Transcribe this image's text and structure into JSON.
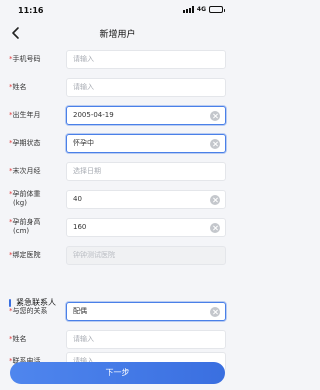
{
  "status": {
    "time": "11:16",
    "network": "4G",
    "battery_level": 0.85
  },
  "nav": {
    "title": "新增用户",
    "back_icon": "chevron-left-icon"
  },
  "fields": [
    {
      "label": "手机号码",
      "required": true,
      "value": "",
      "placeholder": "请输入"
    },
    {
      "label": "姓名",
      "required": true,
      "value": "",
      "placeholder": "请输入"
    },
    {
      "label": "出生年月",
      "required": true,
      "value": "2005-04-19",
      "placeholder": ""
    },
    {
      "label": "孕期状态",
      "required": true,
      "value": "怀孕中",
      "placeholder": ""
    },
    {
      "label": "末次月经",
      "required": true,
      "value": "",
      "placeholder": "选择日期"
    },
    {
      "label": "孕前体重",
      "unit": "(kg)",
      "required": true,
      "value": "40",
      "placeholder": ""
    },
    {
      "label": "孕前身高",
      "unit": "(cm)",
      "required": true,
      "value": "160",
      "placeholder": ""
    },
    {
      "label": "绑定医院",
      "required": true,
      "value": "钟钟测试医院",
      "placeholder": ""
    }
  ],
  "emergency": {
    "section_title": "紧急联系人",
    "fields": [
      {
        "label": "与您的关系",
        "required": true,
        "value": "配偶",
        "placeholder": ""
      },
      {
        "label": "姓名",
        "required": true,
        "value": "",
        "placeholder": "请输入"
      },
      {
        "label": "联系电话",
        "required": true,
        "value": "",
        "placeholder": "请输入"
      }
    ]
  },
  "next_button": "下一步",
  "colors": {
    "accent": "#3a6fe0",
    "required": "#e23c3c",
    "background": "#f4f5f8"
  }
}
